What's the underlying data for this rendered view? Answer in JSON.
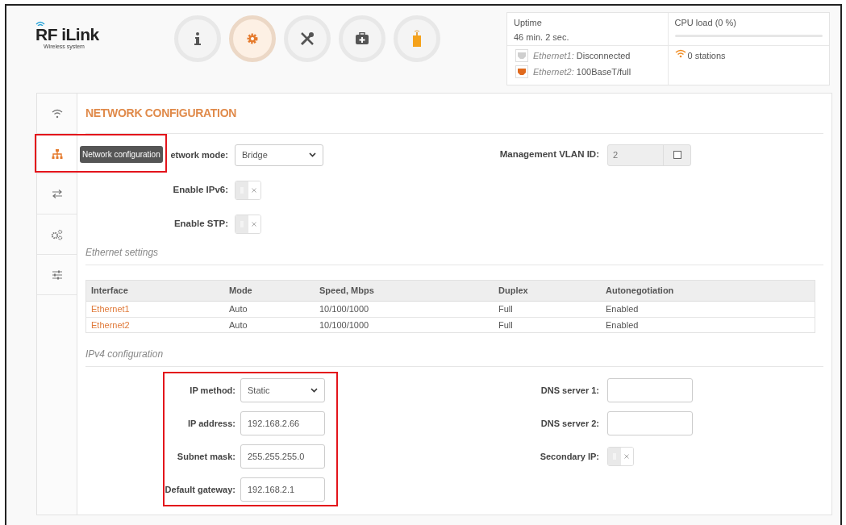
{
  "logo": {
    "name": "RF iLink",
    "tagline": "Wireless system"
  },
  "nav": [
    {
      "selected": false
    },
    {
      "selected": true
    },
    {
      "selected": false
    },
    {
      "selected": false
    },
    {
      "selected": false
    }
  ],
  "status": {
    "uptime_label": "Uptime",
    "uptime": "46 min. 2 sec.",
    "cpu_label": "CPU load (0 %)",
    "level": 0,
    "ports": [
      {
        "name": "Ethernet1:",
        "value": "Disconnected",
        "connected": false
      },
      {
        "name": "Ethernet2:",
        "value": "100BaseT/full",
        "connected": true
      }
    ],
    "stations": "0 stations"
  },
  "sidebar": {
    "items": [
      {
        "selected": false,
        "highlighted": false
      },
      {
        "selected": true,
        "highlighted": true,
        "tooltip": "Network configuration"
      },
      {
        "selected": false,
        "highlighted": false
      },
      {
        "selected": false,
        "highlighted": false
      },
      {
        "selected": false,
        "highlighted": false
      }
    ]
  },
  "title": "NETWORK CONFIGURATION",
  "general": {
    "network_mode": {
      "label": "etwork mode:",
      "value": "Bridge"
    },
    "vlan": {
      "label": "Management VLAN ID:",
      "value": "2",
      "checked": false
    },
    "toggles": [
      {
        "label": "Enable IPv6:",
        "on": false
      },
      {
        "label": "Enable STP:",
        "on": false
      }
    ]
  },
  "ethernet": {
    "heading": "Ethernet settings",
    "columns": [
      "Interface",
      "Mode",
      "Speed, Mbps",
      "Duplex",
      "Autonegotiation"
    ],
    "rows": [
      [
        "Ethernet1",
        "Auto",
        "10/100/1000",
        "Full",
        "Enabled"
      ],
      [
        "Ethernet2",
        "Auto",
        "10/100/1000",
        "Full",
        "Enabled"
      ]
    ]
  },
  "ipv4": {
    "heading": "IPv4 configuration",
    "highlighted": true,
    "left": [
      {
        "kind": "select",
        "label": "IP method:",
        "value": "Static"
      },
      {
        "kind": "input",
        "label": "IP address:",
        "value": "192.168.2.66"
      },
      {
        "kind": "input",
        "label": "Subnet mask:",
        "value": "255.255.255.0"
      },
      {
        "kind": "input",
        "label": "Default gateway:",
        "value": "192.168.2.1"
      }
    ],
    "right": [
      {
        "kind": "input",
        "label": "DNS server 1:"
      },
      {
        "kind": "input",
        "label": "DNS server 2:"
      },
      {
        "kind": "toggle",
        "label": "Secondary IP:",
        "on": false
      }
    ]
  }
}
